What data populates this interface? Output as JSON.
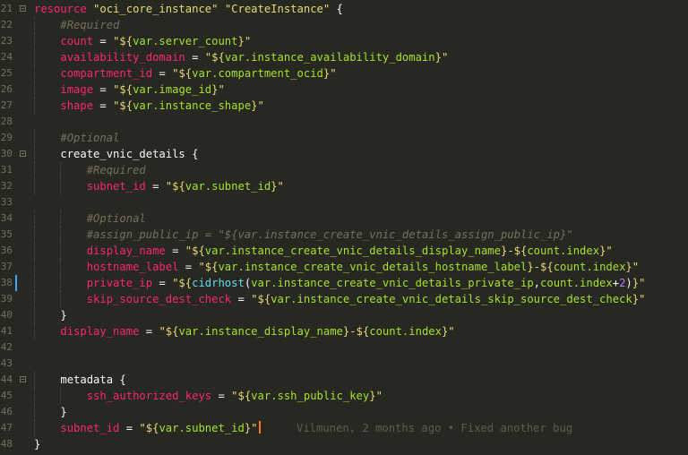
{
  "editor": {
    "lines": [
      {
        "n": "21",
        "fold": true,
        "tokens": [
          {
            "c": "kw",
            "t": "resource"
          },
          {
            "c": "plain",
            "t": " "
          },
          {
            "c": "str",
            "t": "\"oci_core_instance\""
          },
          {
            "c": "plain",
            "t": " "
          },
          {
            "c": "str",
            "t": "\"CreateInstance\""
          },
          {
            "c": "plain",
            "t": " {"
          }
        ]
      },
      {
        "n": "22",
        "tokens": [
          {
            "c": "plain",
            "t": "    "
          },
          {
            "c": "com",
            "t": "#Required"
          }
        ]
      },
      {
        "n": "23",
        "tokens": [
          {
            "c": "plain",
            "t": "    "
          },
          {
            "c": "prop",
            "t": "count"
          },
          {
            "c": "plain",
            "t": " = "
          },
          {
            "c": "str",
            "t": "\"${"
          },
          {
            "c": "var",
            "t": "var.server_count"
          },
          {
            "c": "str",
            "t": "}\""
          }
        ]
      },
      {
        "n": "24",
        "tokens": [
          {
            "c": "plain",
            "t": "    "
          },
          {
            "c": "prop",
            "t": "availability_domain"
          },
          {
            "c": "plain",
            "t": " = "
          },
          {
            "c": "str",
            "t": "\"${"
          },
          {
            "c": "var",
            "t": "var.instance_availability_domain"
          },
          {
            "c": "str",
            "t": "}\""
          }
        ]
      },
      {
        "n": "25",
        "tokens": [
          {
            "c": "plain",
            "t": "    "
          },
          {
            "c": "prop",
            "t": "compartment_id"
          },
          {
            "c": "plain",
            "t": " = "
          },
          {
            "c": "str",
            "t": "\"${"
          },
          {
            "c": "var",
            "t": "var.compartment_ocid"
          },
          {
            "c": "str",
            "t": "}\""
          }
        ]
      },
      {
        "n": "26",
        "tokens": [
          {
            "c": "plain",
            "t": "    "
          },
          {
            "c": "prop",
            "t": "image"
          },
          {
            "c": "plain",
            "t": " = "
          },
          {
            "c": "str",
            "t": "\"${"
          },
          {
            "c": "var",
            "t": "var.image_id"
          },
          {
            "c": "str",
            "t": "}\""
          }
        ]
      },
      {
        "n": "27",
        "tokens": [
          {
            "c": "plain",
            "t": "    "
          },
          {
            "c": "prop",
            "t": "shape"
          },
          {
            "c": "plain",
            "t": " = "
          },
          {
            "c": "str",
            "t": "\"${"
          },
          {
            "c": "var",
            "t": "var.instance_shape"
          },
          {
            "c": "str",
            "t": "}\""
          }
        ]
      },
      {
        "n": "28",
        "tokens": []
      },
      {
        "n": "29",
        "tokens": [
          {
            "c": "plain",
            "t": "    "
          },
          {
            "c": "com",
            "t": "#Optional"
          }
        ]
      },
      {
        "n": "30",
        "fold": true,
        "tokens": [
          {
            "c": "plain",
            "t": "    "
          },
          {
            "c": "plain",
            "t": "create_vnic_details {"
          }
        ]
      },
      {
        "n": "31",
        "tokens": [
          {
            "c": "plain",
            "t": "        "
          },
          {
            "c": "com",
            "t": "#Required"
          }
        ]
      },
      {
        "n": "32",
        "tokens": [
          {
            "c": "plain",
            "t": "        "
          },
          {
            "c": "prop",
            "t": "subnet_id"
          },
          {
            "c": "plain",
            "t": " = "
          },
          {
            "c": "str",
            "t": "\"${"
          },
          {
            "c": "var",
            "t": "var.subnet_id"
          },
          {
            "c": "str",
            "t": "}\""
          }
        ]
      },
      {
        "n": "33",
        "tokens": []
      },
      {
        "n": "34",
        "tokens": [
          {
            "c": "plain",
            "t": "        "
          },
          {
            "c": "com",
            "t": "#Optional"
          }
        ]
      },
      {
        "n": "35",
        "tokens": [
          {
            "c": "plain",
            "t": "        "
          },
          {
            "c": "com",
            "t": "#assign_public_ip = \"${var.instance_create_vnic_details_assign_public_ip}\""
          }
        ]
      },
      {
        "n": "36",
        "tokens": [
          {
            "c": "plain",
            "t": "        "
          },
          {
            "c": "prop",
            "t": "display_name"
          },
          {
            "c": "plain",
            "t": " = "
          },
          {
            "c": "str",
            "t": "\"${"
          },
          {
            "c": "var",
            "t": "var.instance_create_vnic_details_display_name"
          },
          {
            "c": "str",
            "t": "}-${"
          },
          {
            "c": "var",
            "t": "count.index"
          },
          {
            "c": "str",
            "t": "}\""
          }
        ]
      },
      {
        "n": "37",
        "tokens": [
          {
            "c": "plain",
            "t": "        "
          },
          {
            "c": "prop",
            "t": "hostname_label"
          },
          {
            "c": "plain",
            "t": " = "
          },
          {
            "c": "str",
            "t": "\"${"
          },
          {
            "c": "var",
            "t": "var.instance_create_vnic_details_hostname_label"
          },
          {
            "c": "str",
            "t": "}-${"
          },
          {
            "c": "var",
            "t": "count.index"
          },
          {
            "c": "str",
            "t": "}\""
          }
        ]
      },
      {
        "n": "38",
        "modified": true,
        "tokens": [
          {
            "c": "plain",
            "t": "        "
          },
          {
            "c": "prop",
            "t": "private_ip"
          },
          {
            "c": "plain",
            "t": " = "
          },
          {
            "c": "str",
            "t": "\"${"
          },
          {
            "c": "fn",
            "t": "cidrhost"
          },
          {
            "c": "plain",
            "t": "("
          },
          {
            "c": "var",
            "t": "var.instance_create_vnic_details_private_ip"
          },
          {
            "c": "plain",
            "t": ","
          },
          {
            "c": "var",
            "t": "count.index"
          },
          {
            "c": "plain",
            "t": "+"
          },
          {
            "c": "num",
            "t": "2"
          },
          {
            "c": "plain",
            "t": ")"
          },
          {
            "c": "str",
            "t": "}\""
          }
        ]
      },
      {
        "n": "39",
        "tokens": [
          {
            "c": "plain",
            "t": "        "
          },
          {
            "c": "prop",
            "t": "skip_source_dest_check"
          },
          {
            "c": "plain",
            "t": " = "
          },
          {
            "c": "str",
            "t": "\"${"
          },
          {
            "c": "var",
            "t": "var.instance_create_vnic_details_skip_source_dest_check"
          },
          {
            "c": "str",
            "t": "}\""
          }
        ]
      },
      {
        "n": "40",
        "tokens": [
          {
            "c": "plain",
            "t": "    }"
          }
        ]
      },
      {
        "n": "41",
        "tokens": [
          {
            "c": "plain",
            "t": "    "
          },
          {
            "c": "prop",
            "t": "display_name"
          },
          {
            "c": "plain",
            "t": " = "
          },
          {
            "c": "str",
            "t": "\"${"
          },
          {
            "c": "var",
            "t": "var.instance_display_name"
          },
          {
            "c": "str",
            "t": "}-${"
          },
          {
            "c": "var",
            "t": "count.index"
          },
          {
            "c": "str",
            "t": "}\""
          }
        ]
      },
      {
        "n": "42",
        "tokens": []
      },
      {
        "n": "43",
        "tokens": []
      },
      {
        "n": "44",
        "fold": true,
        "tokens": [
          {
            "c": "plain",
            "t": "    "
          },
          {
            "c": "plain",
            "t": "metadata {"
          }
        ]
      },
      {
        "n": "45",
        "tokens": [
          {
            "c": "plain",
            "t": "        "
          },
          {
            "c": "prop",
            "t": "ssh_authorized_keys"
          },
          {
            "c": "plain",
            "t": " = "
          },
          {
            "c": "str",
            "t": "\"${"
          },
          {
            "c": "var",
            "t": "var.ssh_public_key"
          },
          {
            "c": "str",
            "t": "}\""
          }
        ]
      },
      {
        "n": "46",
        "tokens": [
          {
            "c": "plain",
            "t": "    }"
          }
        ]
      },
      {
        "n": "47",
        "cursor": true,
        "tokens": [
          {
            "c": "plain",
            "t": "    "
          },
          {
            "c": "prop",
            "t": "subnet_id"
          },
          {
            "c": "plain",
            "t": " = "
          },
          {
            "c": "str",
            "t": "\"${"
          },
          {
            "c": "var",
            "t": "var.subnet_id"
          },
          {
            "c": "str",
            "t": "}\""
          }
        ],
        "blame": "Vilmunen, 2 months ago • Fixed another bug"
      },
      {
        "n": "48",
        "tokens": [
          {
            "c": "plain",
            "t": "}"
          }
        ]
      }
    ]
  }
}
